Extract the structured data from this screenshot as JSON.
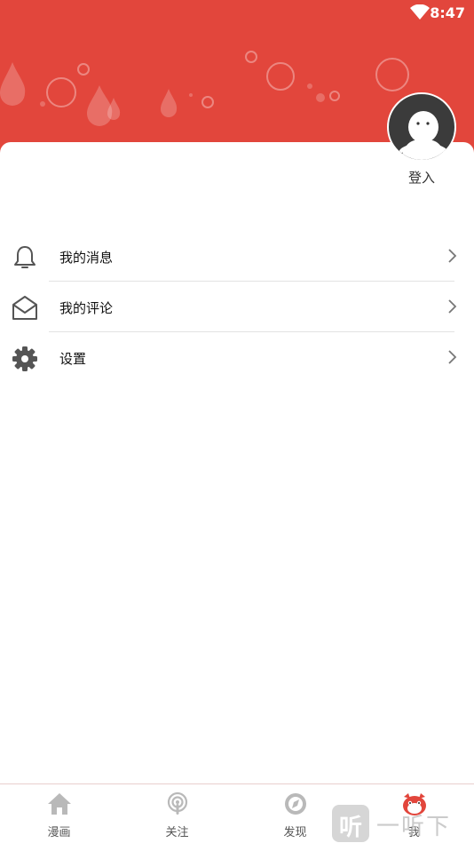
{
  "status_bar": {
    "time": "8:47",
    "wifi_icon": "wifi-icon"
  },
  "header": {
    "background_color": "#e2463c"
  },
  "profile": {
    "login_label": "登入",
    "avatar_icon": "avatar-icon"
  },
  "menu": {
    "items": [
      {
        "label": "我的消息",
        "icon": "bell-icon"
      },
      {
        "label": "我的评论",
        "icon": "envelope-icon"
      },
      {
        "label": "设置",
        "icon": "gear-icon"
      }
    ]
  },
  "tabbar": {
    "active_color": "#e2463c",
    "tabs": [
      {
        "label": "漫画",
        "icon": "home-icon",
        "active": false
      },
      {
        "label": "关注",
        "icon": "podcast-icon",
        "active": false
      },
      {
        "label": "发现",
        "icon": "compass-icon",
        "active": false
      },
      {
        "label": "我",
        "icon": "mascot-icon",
        "active": true
      }
    ]
  },
  "watermark": {
    "badge": "听",
    "text": "一听下载"
  }
}
